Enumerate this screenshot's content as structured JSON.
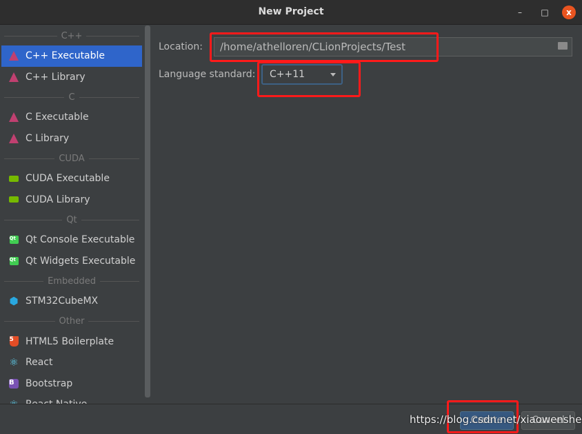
{
  "window": {
    "title": "New Project",
    "min": "–",
    "max": "□",
    "close": "x"
  },
  "sidebar": [
    {
      "type": "header",
      "label": "C++"
    },
    {
      "type": "item",
      "label": "C++ Executable",
      "icon": "clion-icon",
      "selected": true
    },
    {
      "type": "item",
      "label": "C++ Library",
      "icon": "clion-icon"
    },
    {
      "type": "header",
      "label": "C"
    },
    {
      "type": "item",
      "label": "C Executable",
      "icon": "clion-icon"
    },
    {
      "type": "item",
      "label": "C Library",
      "icon": "clion-icon"
    },
    {
      "type": "header",
      "label": "CUDA"
    },
    {
      "type": "item",
      "label": "CUDA Executable",
      "icon": "nvidia-icon"
    },
    {
      "type": "item",
      "label": "CUDA Library",
      "icon": "nvidia-icon"
    },
    {
      "type": "header",
      "label": "Qt"
    },
    {
      "type": "item",
      "label": "Qt Console Executable",
      "icon": "qt-icon"
    },
    {
      "type": "item",
      "label": "Qt Widgets Executable",
      "icon": "qt-icon"
    },
    {
      "type": "header",
      "label": "Embedded"
    },
    {
      "type": "item",
      "label": "STM32CubeMX",
      "icon": "cube-icon"
    },
    {
      "type": "header",
      "label": "Other"
    },
    {
      "type": "item",
      "label": "HTML5 Boilerplate",
      "icon": "html5-icon"
    },
    {
      "type": "item",
      "label": "React",
      "icon": "react-icon"
    },
    {
      "type": "item",
      "label": "Bootstrap",
      "icon": "bootstrap-icon"
    },
    {
      "type": "item",
      "label": "React Native",
      "icon": "react-icon"
    }
  ],
  "form": {
    "location_label": "Location:",
    "location_value": "/home/athelloren/CLionProjects/Test",
    "language_label": "Language standard:",
    "language_value": "C++11"
  },
  "buttons": {
    "create": "Create",
    "cancel": "Cancel"
  },
  "watermark": "https://blog.csdn.net/xiaowenshen",
  "colors": {
    "accent": "#2f65ca",
    "highlight": "#ff1a1a",
    "close": "#e95420"
  }
}
